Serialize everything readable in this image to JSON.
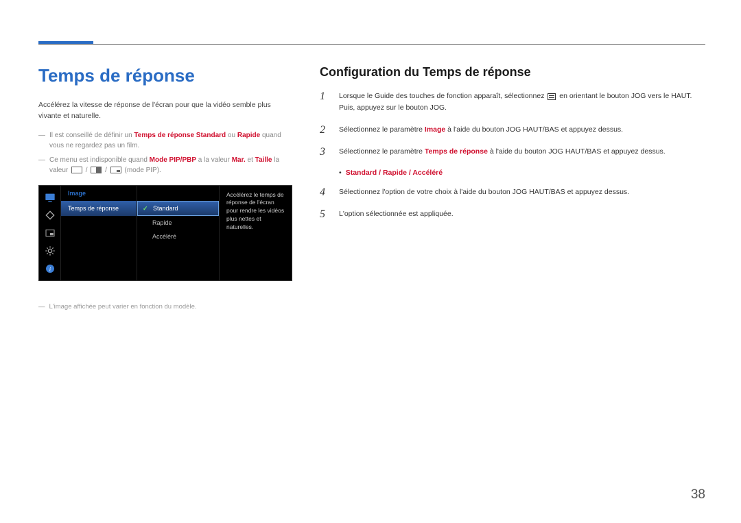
{
  "page_number": "38",
  "left": {
    "heading": "Temps de réponse",
    "intro": "Accélérez la vitesse de réponse de l'écran pour que la vidéo semble plus vivante et naturelle.",
    "note1_pre": "Il est conseillé de définir un ",
    "note1_bold1": "Temps de réponse Standard",
    "note1_mid": " ou ",
    "note1_bold2": "Rapide",
    "note1_post": " quand vous ne regardez pas un film.",
    "note2_pre": "Ce menu est indisponible quand ",
    "note2_bold1": "Mode PIP/PBP",
    "note2_mid1": " a la valeur ",
    "note2_bold2": "Mar.",
    "note2_mid2": " et ",
    "note2_bold3": "Taille",
    "note2_mid3": " la valeur ",
    "note2_post": "(mode PIP).",
    "footer_note": "L'image affichée peut varier en fonction du modèle."
  },
  "osd": {
    "section": "Image",
    "menu_item": "Temps de réponse",
    "options": [
      "Standard",
      "Rapide",
      "Accéléré"
    ],
    "selected_index": 0,
    "help": "Accélérez le temps de réponse de l'écran pour rendre les vidéos plus nettes et naturelles."
  },
  "right": {
    "heading": "Configuration du Temps de réponse",
    "step1_pre": "Lorsque le Guide des touches de fonction apparaît, sélectionnez ",
    "step1_post": " en orientant le bouton JOG vers le HAUT. Puis, appuyez sur le bouton JOG.",
    "step2_pre": "Sélectionnez le paramètre ",
    "step2_bold": "Image",
    "step2_post": " à l'aide du bouton JOG HAUT/BAS et appuyez dessus.",
    "step3_pre": "Sélectionnez le paramètre ",
    "step3_bold": "Temps de réponse",
    "step3_post": " à l'aide du bouton JOG HAUT/BAS et appuyez dessus.",
    "option_line": "Standard / Rapide / Accéléré",
    "step4": "Sélectionnez l'option de votre choix à l'aide du bouton JOG HAUT/BAS et appuyez dessus.",
    "step5": "L'option sélectionnée est appliquée."
  }
}
